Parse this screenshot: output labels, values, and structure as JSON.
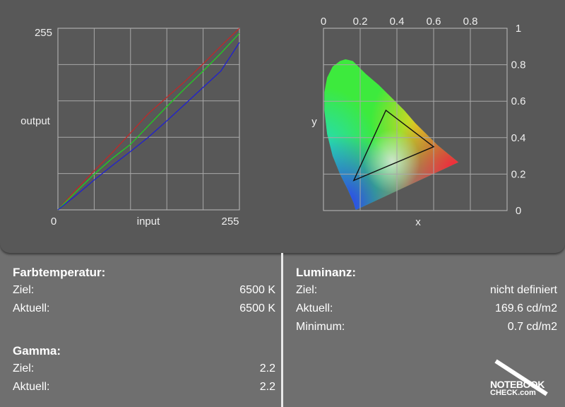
{
  "chart_data": [
    {
      "type": "line",
      "xlabel": "input",
      "ylabel": "output",
      "xlim": [
        0,
        255
      ],
      "ylim": [
        0,
        255
      ],
      "x_ticks": [
        "0",
        "255"
      ],
      "y_ticks": [
        "255"
      ],
      "grid": true,
      "x": [
        0,
        25,
        51,
        76,
        102,
        127,
        153,
        178,
        204,
        229,
        255
      ],
      "series": [
        {
          "color": "#c02828",
          "values": [
            0,
            28,
            55,
            80,
            108,
            135,
            158,
            180,
            205,
            230,
            255
          ]
        },
        {
          "color": "#20d020",
          "values": [
            0,
            25,
            50,
            72,
            92,
            118,
            145,
            170,
            195,
            220,
            248
          ]
        },
        {
          "color": "#2020d0",
          "values": [
            0,
            20,
            42,
            62,
            82,
            102,
            125,
            148,
            172,
            195,
            235
          ]
        }
      ]
    },
    {
      "type": "scatter",
      "xlabel": "x",
      "ylabel": "y",
      "x_ticks": [
        "0",
        "0.2",
        "0.4",
        "0.6",
        "0.8"
      ],
      "y_ticks": [
        "0",
        "0.2",
        "0.4",
        "0.6",
        "0.8",
        "1"
      ],
      "xlim": [
        0,
        1
      ],
      "ylim": [
        0,
        1
      ],
      "grid": true,
      "locus": [
        [
          0.175,
          0.005
        ],
        [
          0.17,
          0.02
        ],
        [
          0.165,
          0.04
        ],
        [
          0.152,
          0.07
        ],
        [
          0.13,
          0.12
        ],
        [
          0.09,
          0.2
        ],
        [
          0.05,
          0.3
        ],
        [
          0.02,
          0.42
        ],
        [
          0.005,
          0.55
        ],
        [
          0.005,
          0.65
        ],
        [
          0.02,
          0.73
        ],
        [
          0.05,
          0.79
        ],
        [
          0.09,
          0.82
        ],
        [
          0.12,
          0.83
        ],
        [
          0.16,
          0.82
        ],
        [
          0.23,
          0.75
        ],
        [
          0.3,
          0.69
        ],
        [
          0.37,
          0.62
        ],
        [
          0.44,
          0.55
        ],
        [
          0.5,
          0.48
        ],
        [
          0.56,
          0.42
        ],
        [
          0.62,
          0.36
        ],
        [
          0.68,
          0.31
        ],
        [
          0.735,
          0.265
        ],
        [
          0.18,
          0.005
        ]
      ],
      "gamut_triangle": [
        [
          0.34,
          0.55
        ],
        [
          0.6,
          0.35
        ],
        [
          0.165,
          0.165
        ]
      ],
      "colors": {
        "red": "#ff1e3c",
        "green": "#3dea3d",
        "blue": "#2a3aff",
        "yellow": "#f5d21c",
        "white": "#e4e4e4"
      }
    }
  ],
  "farbtemperatur": {
    "title": "Farbtemperatur:",
    "ziel_label": "Ziel:",
    "ziel_value": "6500 K",
    "aktuell_label": "Aktuell:",
    "aktuell_value": "6500 K"
  },
  "gamma": {
    "title": "Gamma:",
    "ziel_label": "Ziel:",
    "ziel_value": "2.2",
    "aktuell_label": "Aktuell:",
    "aktuell_value": "2.2"
  },
  "luminanz": {
    "title": "Luminanz:",
    "ziel_label": "Ziel:",
    "ziel_value": "nicht definiert",
    "aktuell_label": "Aktuell:",
    "aktuell_value": "169.6 cd/m2",
    "minimum_label": "Minimum:",
    "minimum_value": "0.7 cd/m2"
  },
  "logo": {
    "line1": "NOTEBOOK",
    "line2": "CHECK.com"
  }
}
